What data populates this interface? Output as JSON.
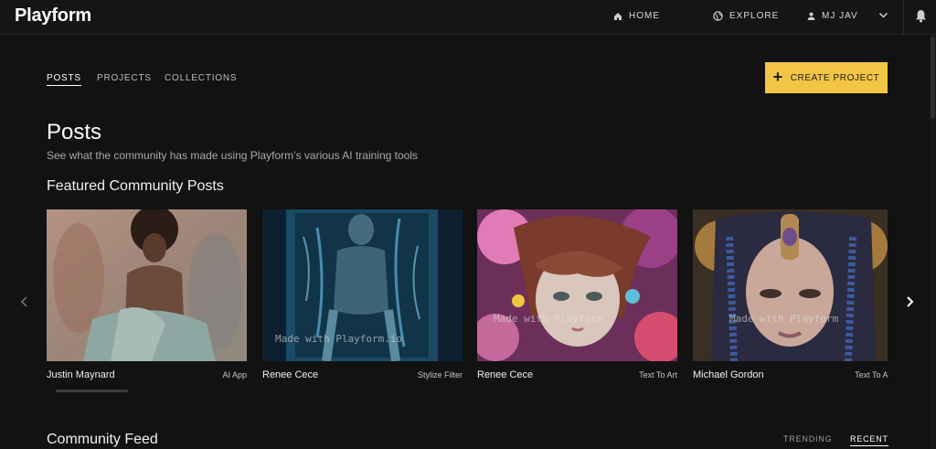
{
  "brand": {
    "logo_text": "Playform"
  },
  "nav": {
    "home_label": "HOME",
    "explore_label": "EXPLORE",
    "user_label": "MJ JAV"
  },
  "tabs": {
    "posts": "POSTS",
    "projects": "PROJECTS",
    "collections": "COLLECTIONS",
    "active": "POSTS"
  },
  "create_button": {
    "label": "CREATE PROJECT",
    "icon": "plus-icon",
    "color": "#f3c545"
  },
  "page": {
    "title": "Posts",
    "subtitle": "See what the community has made using Playform’s various AI training tools"
  },
  "featured": {
    "title": "Featured Community Posts",
    "cards": [
      {
        "author": "Justin Maynard",
        "tool": "AI App",
        "watermark": ""
      },
      {
        "author": "Renee Cece",
        "tool": "Stylize Filter",
        "watermark": "Made with Playform.io"
      },
      {
        "author": "Renee Cece",
        "tool": "Text To Art",
        "watermark": "Made with Playform"
      },
      {
        "author": "Michael Gordon",
        "tool": "Text To Art",
        "watermark": "Made with Playform"
      }
    ]
  },
  "feed": {
    "title": "Community Feed",
    "tab_trending": "TRENDING",
    "tab_recent": "RECENT",
    "active": "RECENT"
  },
  "colors": {
    "background": "#121212",
    "accent": "#f3c545"
  }
}
